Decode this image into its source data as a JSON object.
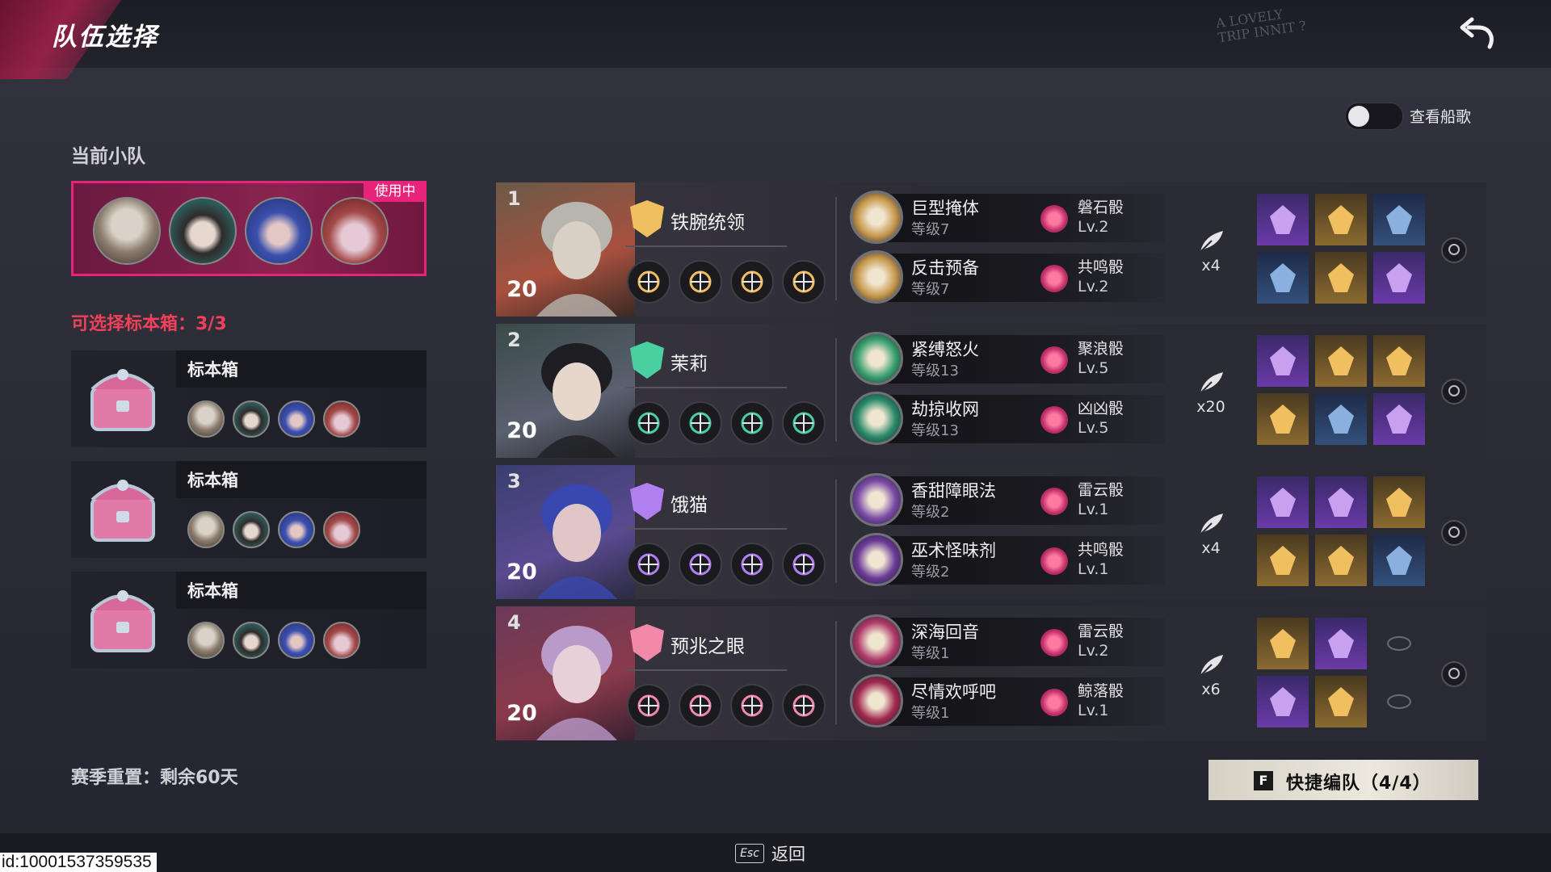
{
  "header": {
    "title": "队伍选择",
    "graffiti": "A LOVELY TRIP INNIT ?",
    "back_icon": "back-arrow-icon"
  },
  "toggle": {
    "label": "查看船歌",
    "state": "off"
  },
  "current_squad": {
    "label": "当前小队",
    "status_tag": "使用中",
    "members": [
      "character-1-avatar",
      "character-2-avatar",
      "character-3-avatar",
      "character-4-avatar"
    ]
  },
  "selectable": {
    "label": "可选择标本箱：3/3"
  },
  "boxes": [
    {
      "name": "标本箱"
    },
    {
      "name": "标本箱"
    },
    {
      "name": "标本箱"
    }
  ],
  "season": {
    "text": "赛季重置：剩余60天"
  },
  "team": [
    {
      "index": "1",
      "level": "20",
      "role": "铁腕统领",
      "abilities": [
        {
          "name": "巨型掩体",
          "level": "等级7",
          "die": "磐石骰",
          "die_level": "Lv.2"
        },
        {
          "name": "反击预备",
          "level": "等级7",
          "die": "共鸣骰",
          "die_level": "Lv.2"
        }
      ],
      "feather_count": "x4",
      "items": [
        "purple",
        "gold",
        "blue",
        "blue",
        "gold",
        "purple"
      ]
    },
    {
      "index": "2",
      "level": "20",
      "role": "茉莉",
      "abilities": [
        {
          "name": "紧缚怒火",
          "level": "等级13",
          "die": "聚浪骰",
          "die_level": "Lv.5"
        },
        {
          "name": "劫掠收网",
          "level": "等级13",
          "die": "凶凶骰",
          "die_level": "Lv.5"
        }
      ],
      "feather_count": "x20",
      "items": [
        "purple",
        "gold",
        "gold",
        "gold",
        "blue",
        "purple"
      ]
    },
    {
      "index": "3",
      "level": "20",
      "role": "饿猫",
      "abilities": [
        {
          "name": "香甜障眼法",
          "level": "等级2",
          "die": "雷云骰",
          "die_level": "Lv.1"
        },
        {
          "name": "巫术怪味剂",
          "level": "等级2",
          "die": "共鸣骰",
          "die_level": "Lv.1"
        }
      ],
      "feather_count": "x4",
      "items": [
        "purple",
        "purple",
        "gold",
        "gold",
        "gold",
        "blue"
      ]
    },
    {
      "index": "4",
      "level": "20",
      "role": "预兆之眼",
      "abilities": [
        {
          "name": "深海回音",
          "level": "等级1",
          "die": "雷云骰",
          "die_level": "Lv.2"
        },
        {
          "name": "尽情欢呼吧",
          "level": "等级1",
          "die": "鲸落骰",
          "die_level": "Lv.1"
        }
      ],
      "feather_count": "x6",
      "items": [
        "gold",
        "purple",
        "empty",
        "purple",
        "gold",
        "empty"
      ]
    }
  ],
  "quick_form": {
    "key": "F",
    "label": "快捷编队（4/4）"
  },
  "footer": {
    "esc_key": "Esc",
    "esc_label": "返回"
  },
  "player_id": "id:10001537359535",
  "colors": {
    "accent": "#e8247a",
    "warning": "#f0405a",
    "bg": "#2b2b36"
  }
}
